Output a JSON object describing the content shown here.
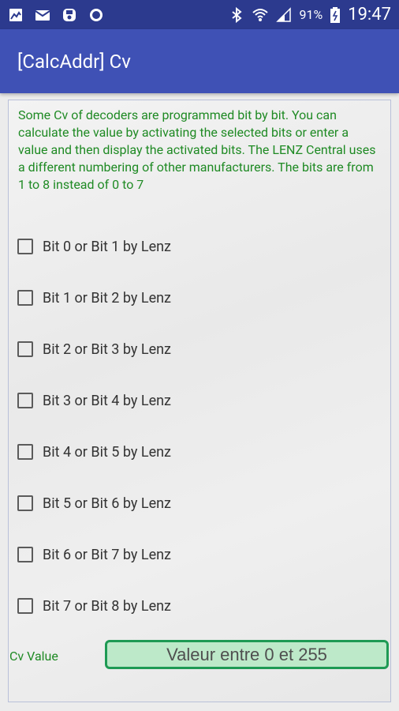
{
  "status_bar": {
    "icons_left": [
      "image-icon",
      "mail-icon",
      "save-icon",
      "circle-icon"
    ],
    "icons_right": [
      "bluetooth-icon",
      "wifi-icon",
      "signal-icon",
      "battery-icon"
    ],
    "battery": "91%",
    "time": "19:47"
  },
  "app_bar": {
    "title": "[CalcAddr] Cv"
  },
  "description": "Some Cv of decoders are programmed bit by bit. You can calculate the value by activating the selected bits or enter a value and then display the activated bits. The LENZ Central uses a different numbering of other manufacturers. The bits are from 1 to 8 instead of 0 to 7",
  "bits": [
    {
      "label": "Bit 0 or Bit 1 by Lenz",
      "checked": false
    },
    {
      "label": "Bit 1 or Bit 2 by Lenz",
      "checked": false
    },
    {
      "label": "Bit 2 or Bit 3 by Lenz",
      "checked": false
    },
    {
      "label": "Bit 3 or Bit 4 by Lenz",
      "checked": false
    },
    {
      "label": "Bit 4 or Bit 5 by Lenz",
      "checked": false
    },
    {
      "label": "Bit 5 or Bit 6 by Lenz",
      "checked": false
    },
    {
      "label": "Bit 6 or Bit 7 by Lenz",
      "checked": false
    },
    {
      "label": "Bit 7 or Bit 8 by Lenz",
      "checked": false
    }
  ],
  "cv_value": {
    "label": "Cv Value",
    "placeholder": "Valeur entre 0 et 255",
    "value": ""
  }
}
